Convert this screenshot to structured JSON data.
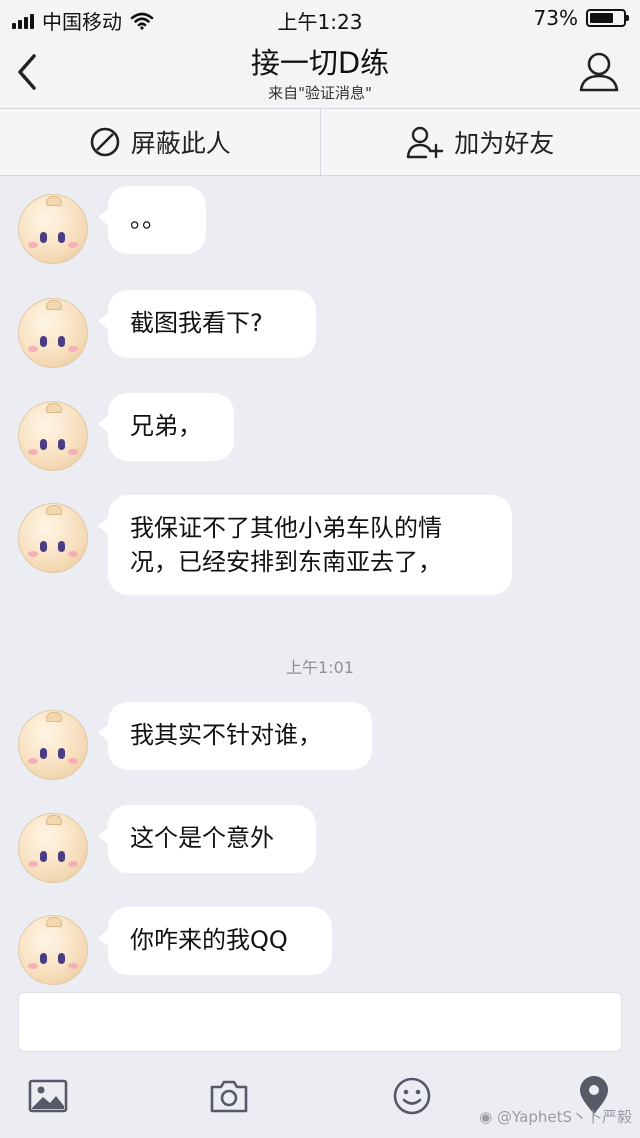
{
  "status_bar": {
    "carrier": "中国移动",
    "time": "上午1:23",
    "battery_percent_text": "73%",
    "battery_level": 0.73
  },
  "header": {
    "title": "接一切D练",
    "subtitle": "来自\"验证消息\""
  },
  "actions": {
    "block_label": "屏蔽此人",
    "add_friend_label": "加为好友"
  },
  "messages": [
    {
      "text": "。。"
    },
    {
      "text": "截图我看下?"
    },
    {
      "text": "兄弟，"
    },
    {
      "text_line1": "我保证不了其他小弟车队的情",
      "text_line2": "况，已经安排到东南亚去了，"
    },
    {
      "text": "我其实不针对谁，"
    },
    {
      "text": "这个是个意外"
    },
    {
      "text": "你咋来的我QQ"
    }
  ],
  "timestamp": "上午1:01",
  "input": {
    "placeholder": ""
  },
  "toolbar": {
    "icons": [
      "image-icon",
      "camera-icon",
      "emoji-icon",
      "location-icon"
    ]
  },
  "watermark": "@YaphetS丶卜严毅",
  "colors": {
    "background": "#ecedf3",
    "bar": "#f4f4f7",
    "bubble": "#ffffff",
    "icon": "#555a66"
  }
}
